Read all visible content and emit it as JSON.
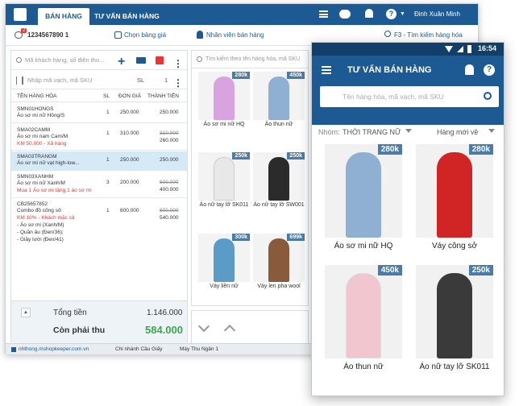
{
  "desktop": {
    "tabs": [
      "BÁN HÀNG",
      "TƯ VẤN BÁN HÀNG"
    ],
    "user": "Đinh Xuân Minh",
    "badge": "2",
    "phone": "1234567890 1",
    "price_list": "Chọn bảng giá",
    "staff": "Nhân viên bán hàng",
    "shortcut": "F3 - Tìm kiếm hàng hóa",
    "customer_placeholder": "Mã khách hàng, số điện tho...",
    "sku_placeholder": "Nhập mã vạch, mã SKU",
    "unit": "SL",
    "qty": "1",
    "product_search_placeholder": "Tìm kiếm theo tên hàng hóa, mã SKU",
    "table_headers": [
      "TÊN HÀNG HÓA",
      "SL",
      "ĐƠN GIÁ",
      "THÀNH TIỀN"
    ],
    "rows": [
      {
        "code": "SMN01HONGS",
        "name": "Áo sơ mi nữ Hồng/S",
        "qty": "1",
        "price": "250.000",
        "total": "250.000",
        "note": "",
        "old": ""
      },
      {
        "code": "SMA02CAMM",
        "name": "Áo sơ mi nam Cam/M",
        "qty": "1",
        "price": "310.000",
        "total": "260.000",
        "note": "KM 50.000 - Xả hàng",
        "old": "310.000"
      },
      {
        "code": "SMA03TRANGM",
        "name": "Áo sơ mi nữ vạt high-low...",
        "qty": "1",
        "price": "250.000",
        "total": "250.000",
        "note": "",
        "old": ""
      },
      {
        "code": "SMN03XANHM",
        "name": "Áo sơ mi nữ Xanh/M",
        "qty": "3",
        "price": "200.000",
        "total": "400.000",
        "note": "Mua 1 Áo sơ mi tặng 1 áo sơ mi",
        "old": "600.000"
      },
      {
        "code": "CB25657852",
        "name": "Combo đồ công sở",
        "qty": "1",
        "price": "600.000",
        "total": "540.000",
        "note": "KM 10% - Khách mặc cả",
        "old": "600.000",
        "extra": [
          "- Áo sơ mi (Xanh/M)",
          "- Quần âu (Đen/36);",
          "- Giầy lười (Đen/41)"
        ]
      }
    ],
    "total_label": "Tổng tiền",
    "total_value": "1.146.000",
    "due_label": "Còn phải thu",
    "due_value": "584.000",
    "products": [
      {
        "name": "Áo sơ mi nữ HQ",
        "price": "280k"
      },
      {
        "name": "Áo thun nữ",
        "price": "450k"
      },
      {
        "name": "Áo nữ tay lỡ SK011",
        "price": "250k"
      },
      {
        "name": "Áo nữ tay lỡ SW001",
        "price": "250k"
      },
      {
        "name": "Váy liền nữ",
        "price": "300k"
      },
      {
        "name": "Váy len pha wool",
        "price": "699k"
      }
    ],
    "status": [
      "nhthong.mshopkeeper.com.vn",
      "Chi nhánh Cầu Giấy",
      "Máy Thu Ngân 1"
    ]
  },
  "mobile": {
    "time": "16:54",
    "title": "TƯ VẤN BÁN HÀNG",
    "search_placeholder": "Tên hàng hóa, mã vạch, mã SKU",
    "group_label": "Nhóm:",
    "group_value": "THỜI TRANG NỮ",
    "sort": "Hàng mới về",
    "products": [
      {
        "name": "Áo sơ mi nữ HQ",
        "price": "280k"
      },
      {
        "name": "Váy công sở",
        "price": "280k"
      },
      {
        "name": "Áo thun nữ",
        "price": "450k"
      },
      {
        "name": "Áo nữ tay lỡ SK011",
        "price": "250k"
      }
    ]
  },
  "colors": {
    "brand": "#1d5a93",
    "accent_green": "#3aa84a",
    "highlight": "#d6e9f7",
    "price_tag": "#4a7ca7"
  }
}
